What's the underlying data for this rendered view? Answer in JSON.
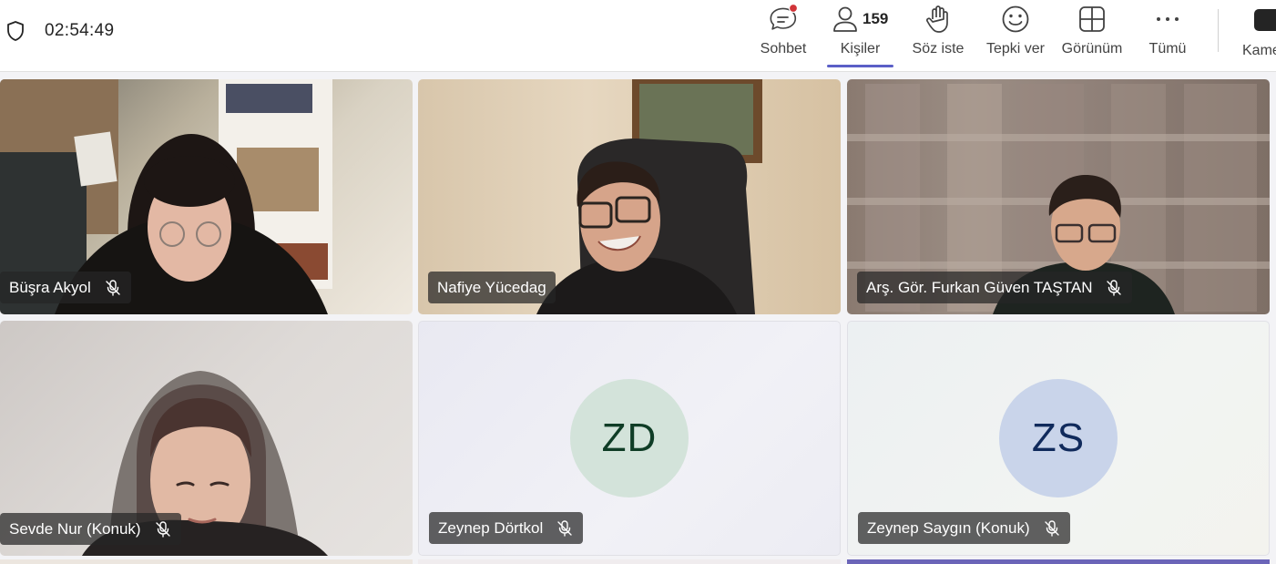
{
  "header": {
    "timer": "02:54:49",
    "people_count": "159",
    "toolbar": [
      {
        "id": "chat",
        "label": "Sohbet",
        "icon": "chat-icon",
        "has_notification": true
      },
      {
        "id": "people",
        "label": "Kişiler",
        "icon": "people-icon",
        "active": true
      },
      {
        "id": "raise-hand",
        "label": "Söz iste",
        "icon": "raise-hand-icon"
      },
      {
        "id": "react",
        "label": "Tepki ver",
        "icon": "smile-icon"
      },
      {
        "id": "view",
        "label": "Görünüm",
        "icon": "grid-view-icon"
      },
      {
        "id": "more",
        "label": "Tümü",
        "icon": "more-icon"
      }
    ],
    "camera_label": "Kame"
  },
  "tiles": [
    {
      "name": "Büşra Akyol",
      "muted": true,
      "video": true
    },
    {
      "name": "Nafiye Yücedag",
      "muted": false,
      "video": true
    },
    {
      "name": "Arş. Gör. Furkan Güven TAŞTAN",
      "muted": true,
      "video": true
    },
    {
      "name": "Sevde Nur (Konuk)",
      "muted": true,
      "video": true
    },
    {
      "name": "Zeynep Dörtkol",
      "muted": true,
      "video": false,
      "initials": "ZD",
      "avatar_bg": "#d3e3da",
      "avatar_fg": "#0f3d26"
    },
    {
      "name": "Zeynep Saygın (Konuk)",
      "muted": true,
      "video": false,
      "initials": "ZS",
      "avatar_bg": "#c9d4ea",
      "avatar_fg": "#102a5c"
    }
  ],
  "colors": {
    "accent": "#5b5fc7",
    "notification": "#d13438"
  }
}
